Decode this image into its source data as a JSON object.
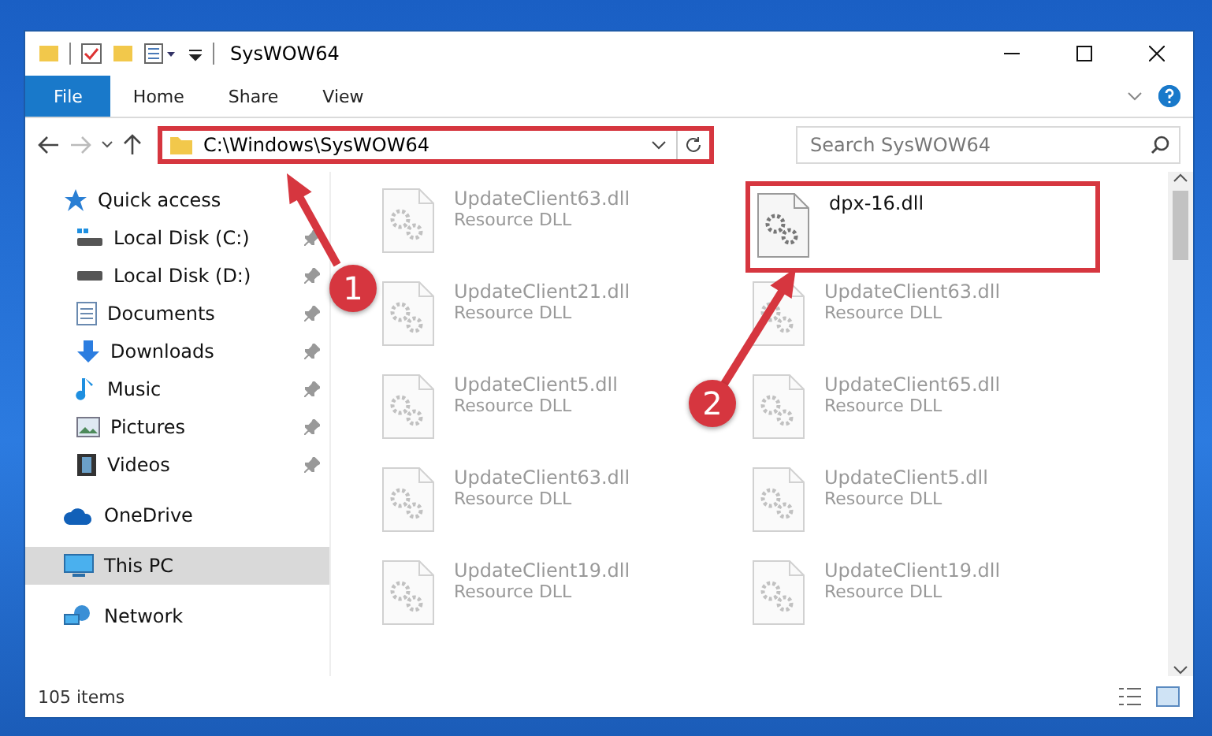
{
  "window": {
    "title": "SysWOW64"
  },
  "ribbon_tabs": [
    {
      "label": "File",
      "kind": "file"
    },
    {
      "label": "Home",
      "kind": "tab"
    },
    {
      "label": "Share",
      "kind": "tab"
    },
    {
      "label": "View",
      "kind": "tab"
    }
  ],
  "address_bar": {
    "path": "C:\\Windows\\SysWOW64",
    "highlighted": true
  },
  "search": {
    "placeholder": "Search SysWOW64"
  },
  "sidebar": {
    "items": [
      {
        "label": "Quick access",
        "kind": "star",
        "selected": false,
        "children": [
          {
            "label": "Local Disk (C:)",
            "kind": "system-drive",
            "pinned": true,
            "selected": false
          },
          {
            "label": "Local Disk (D:)",
            "kind": "drive",
            "pinned": true,
            "selected": false
          },
          {
            "label": "Documents",
            "kind": "document",
            "pinned": true,
            "selected": false
          },
          {
            "label": "Downloads",
            "kind": "download",
            "pinned": true,
            "selected": false
          },
          {
            "label": "Music",
            "kind": "music",
            "pinned": true,
            "selected": false
          },
          {
            "label": "Pictures",
            "kind": "picture",
            "pinned": true,
            "selected": false
          },
          {
            "label": "Videos",
            "kind": "video",
            "pinned": true,
            "selected": false
          }
        ]
      },
      {
        "label": "OneDrive",
        "kind": "cloud",
        "selected": false
      },
      {
        "label": "This PC",
        "kind": "pc",
        "selected": true
      },
      {
        "label": "Network",
        "kind": "network",
        "selected": false
      }
    ]
  },
  "files": [
    {
      "name": "UpdateClient63.dll",
      "type": "Resource DLL",
      "blurred": true,
      "highlighted": false
    },
    {
      "name": "dpx-16.dll",
      "blurred": false,
      "highlighted": true
    },
    {
      "name": "UpdateClient21.dll",
      "type": "Resource DLL",
      "blurred": true,
      "highlighted": false
    },
    {
      "name": "UpdateClient63.dll",
      "type": "Resource DLL",
      "blurred": true,
      "highlighted": false
    },
    {
      "name": "UpdateClient5.dll",
      "type": "Resource DLL",
      "blurred": true,
      "highlighted": false
    },
    {
      "name": "UpdateClient65.dll",
      "type": "Resource DLL",
      "blurred": true,
      "highlighted": false
    },
    {
      "name": "UpdateClient63.dll",
      "type": "Resource DLL",
      "blurred": true,
      "highlighted": false
    },
    {
      "name": "UpdateClient5.dll",
      "type": "Resource DLL",
      "blurred": true,
      "highlighted": false
    },
    {
      "name": "UpdateClient19.dll",
      "type": "Resource DLL",
      "blurred": true,
      "highlighted": false
    },
    {
      "name": "UpdateClient19.dll",
      "type": "Resource DLL",
      "blurred": true,
      "highlighted": false
    }
  ],
  "status_bar": {
    "count": "105 items"
  },
  "callouts": [
    {
      "number": "1"
    },
    {
      "number": "2"
    }
  ]
}
